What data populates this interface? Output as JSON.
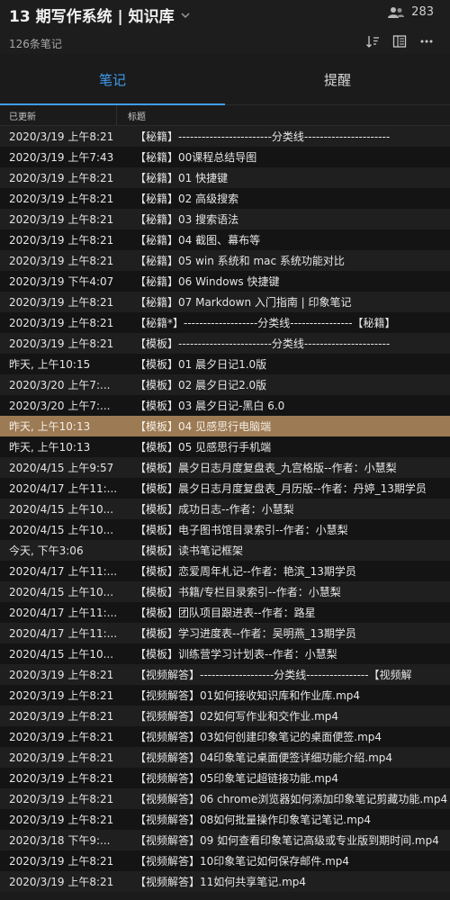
{
  "header": {
    "title": "13 期写作系统 | 知识库",
    "member_count": "283",
    "note_count": "126条笔记",
    "icons": [
      "chevron-down-icon",
      "members-icon",
      "sort-icon",
      "view-toggle-icon",
      "more-icon"
    ]
  },
  "tabs": [
    {
      "label": "笔记",
      "active": true
    },
    {
      "label": "提醒",
      "active": false
    }
  ],
  "columns": {
    "date": "已更新",
    "title": "标题"
  },
  "accent_color": "#3e9cf0",
  "selected_row_color": "#9c7a54",
  "selected_index": 14,
  "rows": [
    {
      "date": "2020/3/19 上午8:21",
      "title": "【秘籍】------------------------分类线----------------------"
    },
    {
      "date": "2020/3/19 上午7:43",
      "title": "【秘籍】00课程总结导图"
    },
    {
      "date": "2020/3/19 上午8:21",
      "title": "【秘籍】01 快捷键"
    },
    {
      "date": "2020/3/19 上午8:21",
      "title": "【秘籍】02 高级搜索"
    },
    {
      "date": "2020/3/19 上午8:21",
      "title": "【秘籍】03 搜索语法"
    },
    {
      "date": "2020/3/19 上午8:21",
      "title": "【秘籍】04 截图、幕布等"
    },
    {
      "date": "2020/3/19 上午8:21",
      "title": "【秘籍】05 win 系统和 mac 系统功能对比"
    },
    {
      "date": "2020/3/19 下午4:07",
      "title": "【秘籍】06 Windows 快捷键"
    },
    {
      "date": "2020/3/19 上午8:21",
      "title": "【秘籍】07 Markdown 入门指南 | 印象笔记"
    },
    {
      "date": "2020/3/19 上午8:21",
      "title": "【秘籍*】-------------------分类线----------------【秘籍】"
    },
    {
      "date": "2020/3/19 上午8:21",
      "title": "【模板】------------------------分类线----------------------"
    },
    {
      "date": "昨天, 上午10:15",
      "title": "【模板】01 晨夕日记1.0版"
    },
    {
      "date": "2020/3/20 上午7:...",
      "title": "【模板】02 晨夕日记2.0版"
    },
    {
      "date": "2020/3/20 上午7:...",
      "title": "【模板】03 晨夕日记-黑白 6.0"
    },
    {
      "date": "昨天, 上午10:13",
      "title": "【模板】04 见感思行电脑端"
    },
    {
      "date": "昨天, 上午10:13",
      "title": "【模板】05 见感思行手机端"
    },
    {
      "date": "2020/4/15 上午9:57",
      "title": "【模板】晨夕日志月度复盘表_九宫格版--作者：小慧梨"
    },
    {
      "date": "2020/4/17 上午11:...",
      "title": "【模板】晨夕日志月度复盘表_月历版--作者：丹婷_13期学员"
    },
    {
      "date": "2020/4/15 上午10...",
      "title": "【模板】成功日志--作者：小慧梨"
    },
    {
      "date": "2020/4/15 上午10...",
      "title": "【模板】电子图书馆目录索引--作者：小慧梨"
    },
    {
      "date": "今天, 下午3:06",
      "title": "【模板】读书笔记框架"
    },
    {
      "date": "2020/4/17 上午11:...",
      "title": "【模板】恋爱周年札记--作者：艳滨_13期学员"
    },
    {
      "date": "2020/4/15 上午10...",
      "title": "【模板】书籍/专栏目录索引--作者：小慧梨"
    },
    {
      "date": "2020/4/17 上午11:...",
      "title": "【模板】团队项目跟进表--作者：路星"
    },
    {
      "date": "2020/4/17 上午11:...",
      "title": "【模板】学习进度表--作者：吴明燕_13期学员"
    },
    {
      "date": "2020/4/15 上午10...",
      "title": "【模板】训练营学习计划表--作者：小慧梨"
    },
    {
      "date": "2020/3/19 上午8:21",
      "title": "【视频解答】-------------------分类线----------------【视频解"
    },
    {
      "date": "2020/3/19 上午8:21",
      "title": "【视频解答】01如何接收知识库和作业库.mp4"
    },
    {
      "date": "2020/3/19 上午8:21",
      "title": "【视频解答】02如何写作业和交作业.mp4"
    },
    {
      "date": "2020/3/19 上午8:21",
      "title": "【视频解答】03如何创建印象笔记的桌面便签.mp4"
    },
    {
      "date": "2020/3/19 上午8:21",
      "title": "【视频解答】04印象笔记桌面便签详细功能介绍.mp4"
    },
    {
      "date": "2020/3/19 上午8:21",
      "title": "【视频解答】05印象笔记超链接功能.mp4"
    },
    {
      "date": "2020/3/19 上午8:21",
      "title": "【视频解答】06 chrome浏览器如何添加印象笔记剪藏功能.mp4"
    },
    {
      "date": "2020/3/19 上午8:21",
      "title": "【视频解答】08如何批量操作印象笔记笔记.mp4"
    },
    {
      "date": "2020/3/18 下午9:...",
      "title": "【视频解答】09 如何查看印象笔记高级或专业版到期时间.mp4"
    },
    {
      "date": "2020/3/19 上午8:21",
      "title": "【视频解答】10印象笔记如何保存邮件.mp4"
    },
    {
      "date": "2020/3/19 上午8:21",
      "title": "【视频解答】11如何共享笔记.mp4"
    }
  ]
}
